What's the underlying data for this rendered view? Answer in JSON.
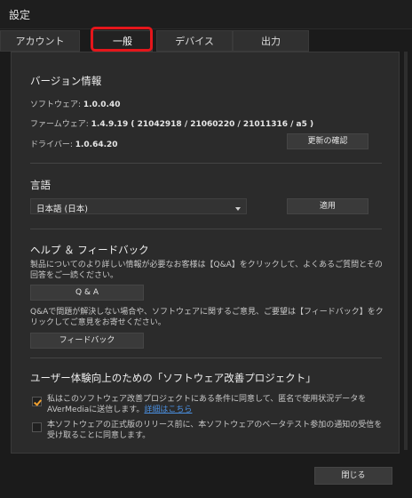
{
  "window": {
    "title": "設定"
  },
  "tabs": [
    {
      "label": "アカウント"
    },
    {
      "label": "一般"
    },
    {
      "label": "デバイス"
    },
    {
      "label": "出力"
    }
  ],
  "version": {
    "heading": "バージョン情報",
    "software_label": "ソフトウェア:",
    "software_value": "1.0.0.40",
    "firmware_label": "ファームウェア:",
    "firmware_value": "1.4.9.19 ( 21042918 / 21060220 / 21011316 / a5 )",
    "driver_label": "ドライバー:",
    "driver_value": "1.0.64.20",
    "check_update_label": "更新の確認"
  },
  "language": {
    "heading": "言語",
    "selected": "日本語 (日本)",
    "apply_label": "適用"
  },
  "help": {
    "heading": "ヘルプ ＆ フィードバック",
    "faq_text": "製品についてのより詳しい情報が必要なお客様は【Q&A】をクリックして、よくあるご質問とその回答をご一読ください。",
    "qa_label": "Q & A",
    "feedback_text": "Q&Aで問題が解決しない場合や、ソフトウェアに関するご意見、ご要望は【フィードバック】をクリックしてご意見をお寄せください。",
    "feedback_label": "フィードバック"
  },
  "improvement": {
    "heading": "ユーザー体験向上のための「ソフトウェア改善プロジェクト」",
    "option1_text": "私はこのソフトウェア改善プロジェクトにある条件に同意して、匿名で使用状況データをAVerMediaに送信します。",
    "option1_link": "詳細はこちら",
    "option1_checked": true,
    "option2_text": "本ソフトウェアの正式版のリリース前に、本ソフトウェアのベータテスト参加の通知の受信を受け取ることに同意します。",
    "option2_checked": false
  },
  "footer": {
    "close_label": "閉じる"
  },
  "colors": {
    "highlight": "#e5161b",
    "accent": "#f0a030",
    "link": "#4a8fe0"
  }
}
